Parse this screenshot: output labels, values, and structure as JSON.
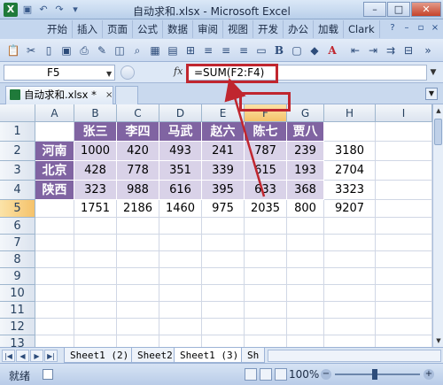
{
  "title": {
    "app_text": "自动求和.xlsx - Microsoft Excel",
    "buttons": [
      "–",
      "□",
      "✕"
    ]
  },
  "ribbon_tabs": [
    "开始",
    "插入",
    "页面",
    "公式",
    "数据",
    "审阅",
    "视图",
    "开发",
    "办公",
    "加载",
    "Clark"
  ],
  "formula_bar": {
    "name_box": "F5",
    "fx": "fx",
    "formula": "=SUM(F2:F4)"
  },
  "document_tab": {
    "label": "自动求和.xlsx *",
    "close": "×"
  },
  "columns": [
    "A",
    "B",
    "C",
    "D",
    "E",
    "F",
    "G",
    "H",
    "I"
  ],
  "rows": [
    "1",
    "2",
    "3",
    "4",
    "5",
    "6",
    "7",
    "8",
    "9",
    "10",
    "11",
    "12",
    "13"
  ],
  "table": {
    "headers": [
      "张三",
      "李四",
      "马武",
      "赵六",
      "陈七",
      "贾八"
    ],
    "row_labels": [
      "河南",
      "北京",
      "陕西"
    ],
    "values": [
      [
        "1000",
        "420",
        "493",
        "241",
        "787",
        "239"
      ],
      [
        "428",
        "778",
        "351",
        "339",
        "615",
        "193"
      ],
      [
        "323",
        "988",
        "616",
        "395",
        "633",
        "368"
      ]
    ],
    "row_totals": [
      "3180",
      "2704",
      "3323"
    ],
    "col_totals": [
      "1751",
      "2186",
      "1460",
      "975",
      "2035",
      "800"
    ],
    "grand_total": "9207"
  },
  "sheet_tabs": [
    "Sheet1 (2)",
    "Sheet2",
    "Sheet1 (3)",
    "Sh"
  ],
  "sheet_nav": [
    "|◀",
    "◀",
    "▶",
    "▶|"
  ],
  "status": {
    "ready": "就绪",
    "zoom": "100%",
    "minus": "−",
    "plus": "+"
  },
  "accent": {
    "header_fill": "#8064a2",
    "data_fill": "#d9d2e8",
    "highlight": "#c0262f"
  }
}
